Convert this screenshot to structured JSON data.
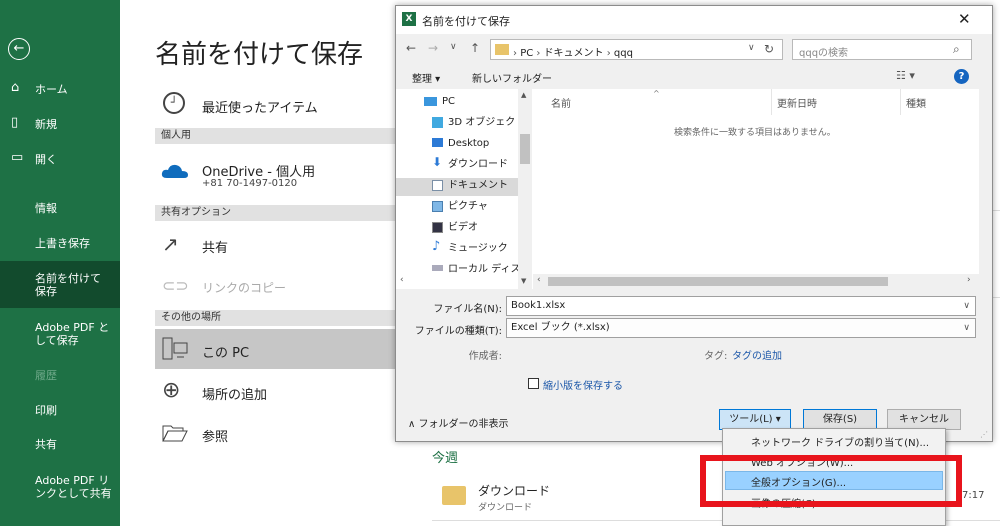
{
  "sidebar": {
    "items": [
      {
        "label": "ホーム",
        "icon": "home-icon",
        "glyph": "⌂"
      },
      {
        "label": "新規",
        "icon": "new-doc-icon",
        "glyph": "▯"
      },
      {
        "label": "開く",
        "icon": "open-folder-icon",
        "glyph": "▭"
      },
      {
        "label": "情報"
      },
      {
        "label": "上書き保存"
      },
      {
        "label": "名前を付けて保存"
      },
      {
        "label": "Adobe PDF として保存"
      },
      {
        "label": "履歴"
      },
      {
        "label": "印刷"
      },
      {
        "label": "共有"
      },
      {
        "label": "Adobe PDF リンクとして共有"
      }
    ]
  },
  "saveas": {
    "title": "名前を付けて保存",
    "recent": "最近使ったアイテム",
    "personal_header": "個人用",
    "onedrive": "OneDrive - 個人用",
    "onedrive_phone": "+81 70-1497-0120",
    "shared_header": "共有オプション",
    "share": "共有",
    "copy_link": "リンクのコピー",
    "other_header": "その他の場所",
    "this_pc": "この PC",
    "add_place": "場所の追加",
    "browse": "参照",
    "this_week": "今週",
    "recent_folder": "ダウンロード",
    "recent_folder_sub": "ダウンロード",
    "time_partial": "7:17"
  },
  "dialog": {
    "title": "名前を付けて保存",
    "address": [
      "PC",
      "ドキュメント",
      "qqq"
    ],
    "search_placeholder": "qqqの検索",
    "organize": "整理",
    "new_folder": "新しいフォルダー",
    "tree": [
      "PC",
      "3D オブジェクト",
      "Desktop",
      "ダウンロード",
      "ドキュメント",
      "ピクチャ",
      "ビデオ",
      "ミュージック",
      "ローカル ディスク ("
    ],
    "columns": [
      "名前",
      "更新日時",
      "種類"
    ],
    "empty_msg": "検索条件に一致する項目はありません。",
    "filename_label": "ファイル名(N):",
    "filename_value": "Book1.xlsx",
    "filetype_label": "ファイルの種類(T):",
    "filetype_value": "Excel ブック (*.xlsx)",
    "author_label": "作成者:",
    "tag_label": "タグ:",
    "tag_value": "タグの追加",
    "thumbnail_label": "縮小版を保存する",
    "hide_folders": "フォルダーの非表示",
    "tools": "ツール(L)",
    "save": "保存(S)",
    "cancel": "キャンセル"
  },
  "tools_menu": {
    "items": [
      "ネットワーク ドライブの割り当て(N)...",
      "Web オプション(W)...",
      "全般オプション(G)...",
      "画像の圧縮(C)..."
    ],
    "highlighted_index": 2
  },
  "colors": {
    "sidebar": "#1e7145",
    "sidebar_active": "#124b2d",
    "highlight": "#99d1ff",
    "annotation": "#e8141c",
    "link": "#1a56a8"
  }
}
